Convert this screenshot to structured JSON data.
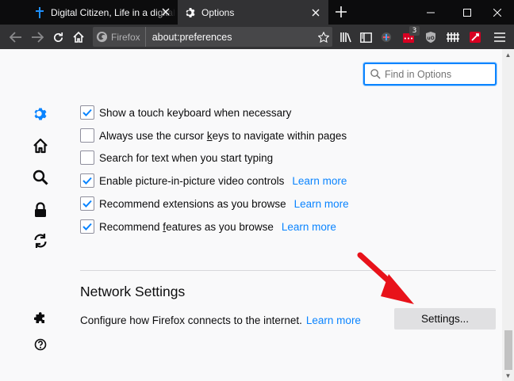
{
  "tabs": [
    {
      "title": "Digital Citizen, Life in a digital world",
      "active": false
    },
    {
      "title": "Options",
      "active": true
    }
  ],
  "toolbar": {
    "identity_label": "Firefox",
    "url": "about:preferences",
    "notification_badge": "3"
  },
  "search": {
    "placeholder": "Find in Options"
  },
  "checkboxes": [
    {
      "label_pre": "Show a touch keyboard when necessary",
      "underline": "",
      "label_post": "",
      "checked": true,
      "link": ""
    },
    {
      "label_pre": "Always use the cursor ",
      "underline": "k",
      "label_post": "eys to navigate within pages",
      "checked": false,
      "link": ""
    },
    {
      "label_pre": "Search for text when you start typing",
      "underline": "",
      "label_post": "",
      "checked": false,
      "link": ""
    },
    {
      "label_pre": "Enable picture-in-picture video controls",
      "underline": "",
      "label_post": "",
      "checked": true,
      "link": "Learn more"
    },
    {
      "label_pre": "Recommend extensions as you browse",
      "underline": "",
      "label_post": "",
      "checked": true,
      "link": "Learn more"
    },
    {
      "label_pre": "Recommend ",
      "underline": "f",
      "label_post": "eatures as you browse",
      "checked": true,
      "link": "Learn more"
    }
  ],
  "network": {
    "title": "Network Settings",
    "description": "Configure how Firefox connects to the internet.",
    "link": "Learn more",
    "button_pre": "Settin",
    "button_underline": "g",
    "button_post": "s..."
  },
  "colors": {
    "accent": "#0a84ff",
    "tabstrip": "#0c0c0d",
    "toolbar": "#323234",
    "annotation_arrow": "#e8121a"
  }
}
